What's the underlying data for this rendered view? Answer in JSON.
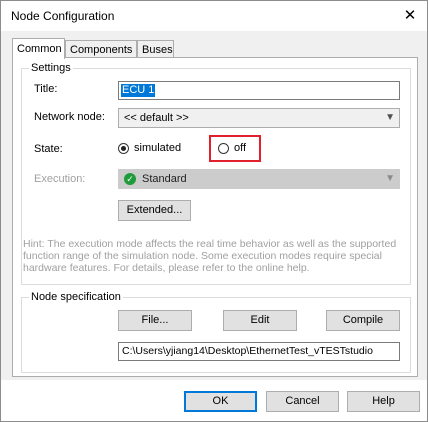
{
  "window": {
    "title": "Node Configuration",
    "close_glyph": "✕"
  },
  "tabs": [
    {
      "label": "Common"
    },
    {
      "label": "Components"
    },
    {
      "label": "Buses"
    }
  ],
  "settings": {
    "group_label": "Settings",
    "title_label": "Title:",
    "title_value": "ECU 1",
    "network_node_label": "Network node:",
    "network_node_value": "<< default >>",
    "state_label": "State:",
    "state_options": [
      {
        "label": "simulated",
        "selected": true
      },
      {
        "label": "off",
        "selected": false
      }
    ],
    "execution_label": "Execution:",
    "execution_value": "Standard",
    "execution_icon": "shield-check-icon",
    "extended_button": "Extended...",
    "hint": "Hint: The execution mode affects the real time behavior as well as the supported function range of the simulation node. Some execution modes require special hardware features. For details, please refer to the online help."
  },
  "node_spec": {
    "group_label": "Node specification",
    "file_button": "File...",
    "edit_button": "Edit",
    "compile_button": "Compile",
    "path_value": "C:\\Users\\yjiang14\\Desktop\\EthernetTest_vTESTstudio"
  },
  "footer": {
    "ok": "OK",
    "cancel": "Cancel",
    "help": "Help"
  },
  "colors": {
    "highlight": "#e0202a",
    "accent": "#0078d7"
  }
}
